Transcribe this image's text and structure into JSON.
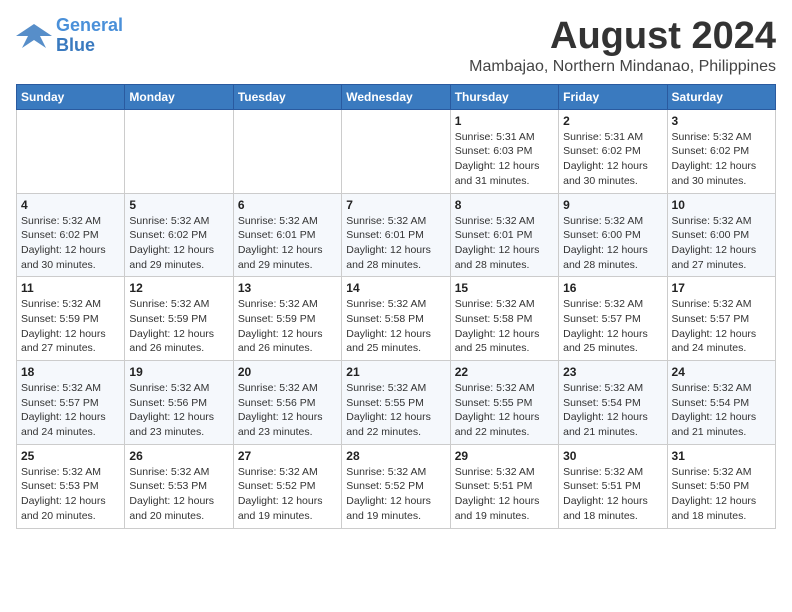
{
  "logo": {
    "line1": "General",
    "line2": "Blue"
  },
  "title": {
    "month_year": "August 2024",
    "location": "Mambajao, Northern Mindanao, Philippines"
  },
  "weekdays": [
    "Sunday",
    "Monday",
    "Tuesday",
    "Wednesday",
    "Thursday",
    "Friday",
    "Saturday"
  ],
  "weeks": [
    [
      {
        "day": "",
        "info": ""
      },
      {
        "day": "",
        "info": ""
      },
      {
        "day": "",
        "info": ""
      },
      {
        "day": "",
        "info": ""
      },
      {
        "day": "1",
        "info": "Sunrise: 5:31 AM\nSunset: 6:03 PM\nDaylight: 12 hours\nand 31 minutes."
      },
      {
        "day": "2",
        "info": "Sunrise: 5:31 AM\nSunset: 6:02 PM\nDaylight: 12 hours\nand 30 minutes."
      },
      {
        "day": "3",
        "info": "Sunrise: 5:32 AM\nSunset: 6:02 PM\nDaylight: 12 hours\nand 30 minutes."
      }
    ],
    [
      {
        "day": "4",
        "info": "Sunrise: 5:32 AM\nSunset: 6:02 PM\nDaylight: 12 hours\nand 30 minutes."
      },
      {
        "day": "5",
        "info": "Sunrise: 5:32 AM\nSunset: 6:02 PM\nDaylight: 12 hours\nand 29 minutes."
      },
      {
        "day": "6",
        "info": "Sunrise: 5:32 AM\nSunset: 6:01 PM\nDaylight: 12 hours\nand 29 minutes."
      },
      {
        "day": "7",
        "info": "Sunrise: 5:32 AM\nSunset: 6:01 PM\nDaylight: 12 hours\nand 28 minutes."
      },
      {
        "day": "8",
        "info": "Sunrise: 5:32 AM\nSunset: 6:01 PM\nDaylight: 12 hours\nand 28 minutes."
      },
      {
        "day": "9",
        "info": "Sunrise: 5:32 AM\nSunset: 6:00 PM\nDaylight: 12 hours\nand 28 minutes."
      },
      {
        "day": "10",
        "info": "Sunrise: 5:32 AM\nSunset: 6:00 PM\nDaylight: 12 hours\nand 27 minutes."
      }
    ],
    [
      {
        "day": "11",
        "info": "Sunrise: 5:32 AM\nSunset: 5:59 PM\nDaylight: 12 hours\nand 27 minutes."
      },
      {
        "day": "12",
        "info": "Sunrise: 5:32 AM\nSunset: 5:59 PM\nDaylight: 12 hours\nand 26 minutes."
      },
      {
        "day": "13",
        "info": "Sunrise: 5:32 AM\nSunset: 5:59 PM\nDaylight: 12 hours\nand 26 minutes."
      },
      {
        "day": "14",
        "info": "Sunrise: 5:32 AM\nSunset: 5:58 PM\nDaylight: 12 hours\nand 25 minutes."
      },
      {
        "day": "15",
        "info": "Sunrise: 5:32 AM\nSunset: 5:58 PM\nDaylight: 12 hours\nand 25 minutes."
      },
      {
        "day": "16",
        "info": "Sunrise: 5:32 AM\nSunset: 5:57 PM\nDaylight: 12 hours\nand 25 minutes."
      },
      {
        "day": "17",
        "info": "Sunrise: 5:32 AM\nSunset: 5:57 PM\nDaylight: 12 hours\nand 24 minutes."
      }
    ],
    [
      {
        "day": "18",
        "info": "Sunrise: 5:32 AM\nSunset: 5:57 PM\nDaylight: 12 hours\nand 24 minutes."
      },
      {
        "day": "19",
        "info": "Sunrise: 5:32 AM\nSunset: 5:56 PM\nDaylight: 12 hours\nand 23 minutes."
      },
      {
        "day": "20",
        "info": "Sunrise: 5:32 AM\nSunset: 5:56 PM\nDaylight: 12 hours\nand 23 minutes."
      },
      {
        "day": "21",
        "info": "Sunrise: 5:32 AM\nSunset: 5:55 PM\nDaylight: 12 hours\nand 22 minutes."
      },
      {
        "day": "22",
        "info": "Sunrise: 5:32 AM\nSunset: 5:55 PM\nDaylight: 12 hours\nand 22 minutes."
      },
      {
        "day": "23",
        "info": "Sunrise: 5:32 AM\nSunset: 5:54 PM\nDaylight: 12 hours\nand 21 minutes."
      },
      {
        "day": "24",
        "info": "Sunrise: 5:32 AM\nSunset: 5:54 PM\nDaylight: 12 hours\nand 21 minutes."
      }
    ],
    [
      {
        "day": "25",
        "info": "Sunrise: 5:32 AM\nSunset: 5:53 PM\nDaylight: 12 hours\nand 20 minutes."
      },
      {
        "day": "26",
        "info": "Sunrise: 5:32 AM\nSunset: 5:53 PM\nDaylight: 12 hours\nand 20 minutes."
      },
      {
        "day": "27",
        "info": "Sunrise: 5:32 AM\nSunset: 5:52 PM\nDaylight: 12 hours\nand 19 minutes."
      },
      {
        "day": "28",
        "info": "Sunrise: 5:32 AM\nSunset: 5:52 PM\nDaylight: 12 hours\nand 19 minutes."
      },
      {
        "day": "29",
        "info": "Sunrise: 5:32 AM\nSunset: 5:51 PM\nDaylight: 12 hours\nand 19 minutes."
      },
      {
        "day": "30",
        "info": "Sunrise: 5:32 AM\nSunset: 5:51 PM\nDaylight: 12 hours\nand 18 minutes."
      },
      {
        "day": "31",
        "info": "Sunrise: 5:32 AM\nSunset: 5:50 PM\nDaylight: 12 hours\nand 18 minutes."
      }
    ]
  ]
}
